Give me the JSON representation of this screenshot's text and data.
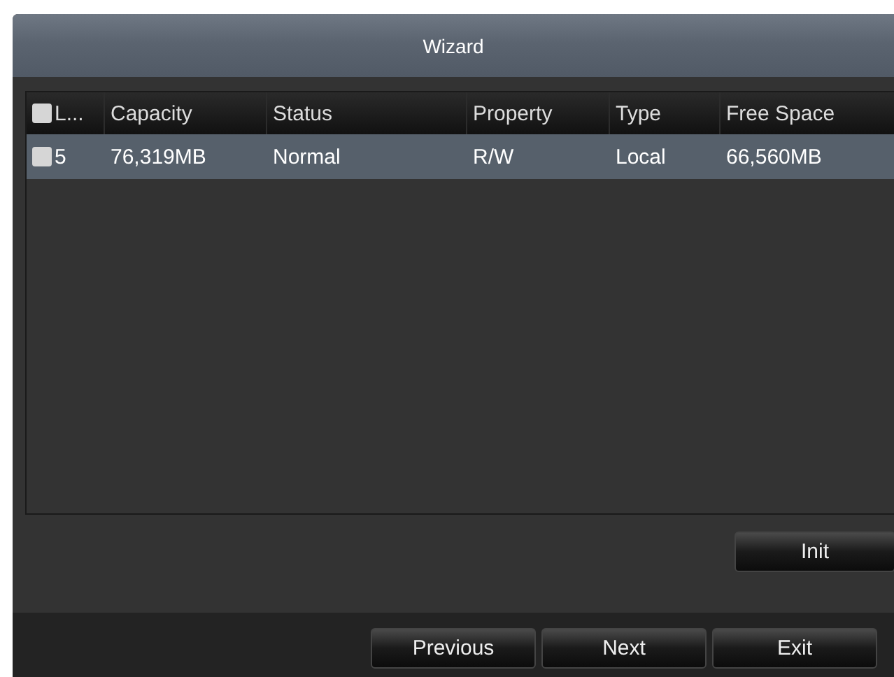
{
  "window": {
    "title": "Wizard"
  },
  "table": {
    "columns": [
      {
        "label": "L...",
        "checked": false
      },
      {
        "label": "Capacity"
      },
      {
        "label": "Status"
      },
      {
        "label": "Property"
      },
      {
        "label": "Type"
      },
      {
        "label": "Free Space"
      }
    ],
    "rows": [
      {
        "selected": true,
        "checked": false,
        "cells": [
          "5",
          "76,319MB",
          "Normal",
          "R/W",
          "Local",
          "66,560MB"
        ]
      }
    ]
  },
  "actions": [
    "Init"
  ],
  "buttons": [
    "Previous",
    "Next",
    "Exit"
  ]
}
